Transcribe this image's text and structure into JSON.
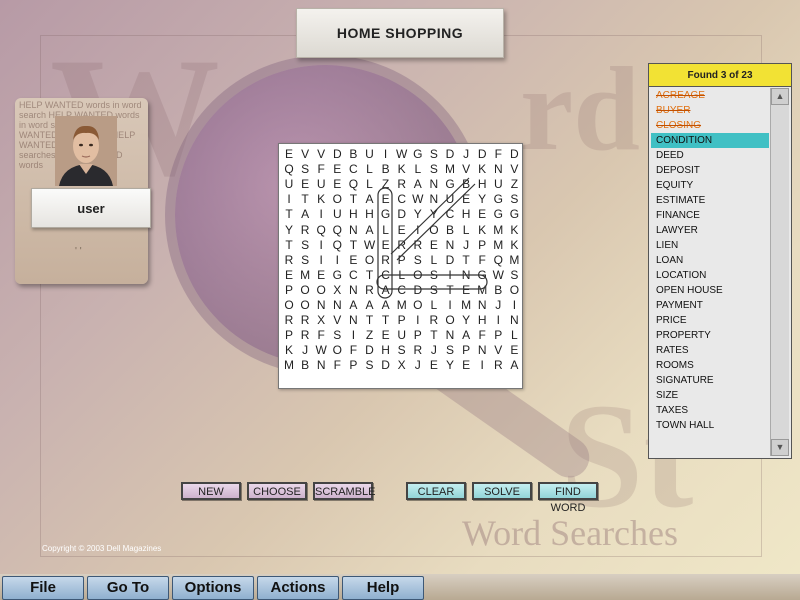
{
  "window": {
    "title": "HOME SHOPPING"
  },
  "player": {
    "name": "user",
    "note": "' '",
    "background_text": "HELP WANTED words in word search HELP WANTED words in word searches HELP WANTED word search HELP WANTED words in word searches HELP WANTED words"
  },
  "background": {
    "watermark": "Word Searches"
  },
  "puzzle": {
    "rows": [
      "EVVDBUIWGSDJDF",
      "QSFECLBKLSMVKN",
      "UEUEQLZRANGBHU",
      "ITKOTAECWNUEYG",
      "TAIUHHGDYYCHEG",
      "YRQQNALEIOBLKM",
      "TSIQTWERRENJPM",
      "RSIIEORPSLDTFQ",
      "EMEGCTCLOSINGW",
      "POOXNRACDSTEMB",
      "OONNAAAMOLIMNJ",
      "RRXVNTTPIROYHI",
      "PRFSIZEUPTNAFP",
      "KJWOFDHSRJSPNV",
      "MBNFPSDXJEYEIR"
    ],
    "extra_col": [
      "D",
      "V",
      "Z",
      "S",
      "G",
      "K",
      "K",
      "M",
      "S",
      "O",
      "I",
      "N",
      "L",
      "E",
      "A"
    ]
  },
  "words_panel": {
    "header": "Found  3  of  23",
    "scroll_up": "▲",
    "scroll_down": "▼",
    "words": [
      {
        "text": "ACREAGE",
        "state": "found"
      },
      {
        "text": "BUYER",
        "state": "found"
      },
      {
        "text": "CLOSING",
        "state": "found"
      },
      {
        "text": "CONDITION",
        "state": "selected"
      },
      {
        "text": "DEED",
        "state": ""
      },
      {
        "text": "DEPOSIT",
        "state": ""
      },
      {
        "text": "EQUITY",
        "state": ""
      },
      {
        "text": "ESTIMATE",
        "state": ""
      },
      {
        "text": "FINANCE",
        "state": ""
      },
      {
        "text": "LAWYER",
        "state": ""
      },
      {
        "text": "LIEN",
        "state": ""
      },
      {
        "text": "LOAN",
        "state": ""
      },
      {
        "text": "LOCATION",
        "state": ""
      },
      {
        "text": "OPEN HOUSE",
        "state": ""
      },
      {
        "text": "PAYMENT",
        "state": ""
      },
      {
        "text": "PRICE",
        "state": ""
      },
      {
        "text": "PROPERTY",
        "state": ""
      },
      {
        "text": "RATES",
        "state": ""
      },
      {
        "text": "ROOMS",
        "state": ""
      },
      {
        "text": "SIGNATURE",
        "state": ""
      },
      {
        "text": "SIZE",
        "state": ""
      },
      {
        "text": "TAXES",
        "state": ""
      },
      {
        "text": "TOWN HALL",
        "state": ""
      }
    ]
  },
  "buttons": {
    "new": "NEW",
    "choose": "CHOOSE",
    "scramble": "SCRAMBLE",
    "clear": "CLEAR",
    "solve": "SOLVE",
    "find_word": "FIND WORD"
  },
  "copyright": "Copyright © 2003 Dell Magazines",
  "menu": {
    "file": "File",
    "goto": "Go To",
    "options": "Options",
    "actions": "Actions",
    "help": "Help"
  },
  "colors": {
    "found_word": "#e07010",
    "selected_word": "#40c0c4",
    "found_header": "#f2e234",
    "menu_button": "#8fb0cf"
  }
}
